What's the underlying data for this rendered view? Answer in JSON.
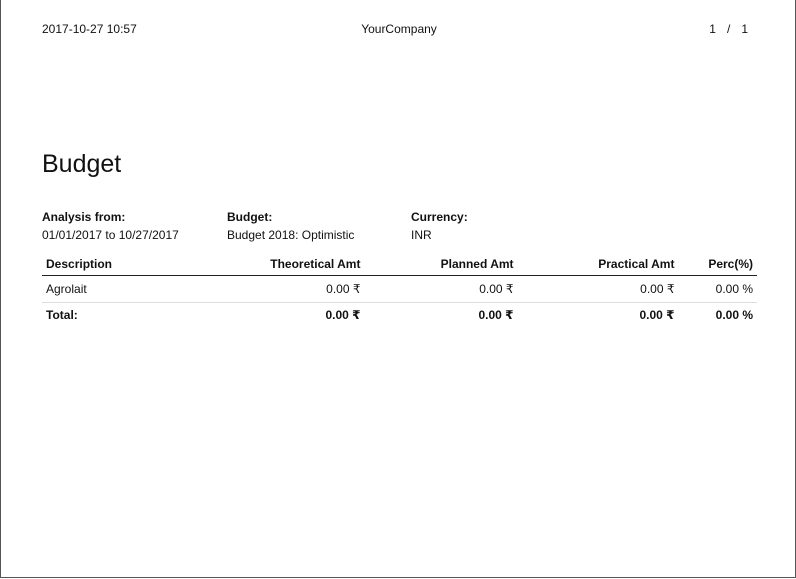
{
  "header": {
    "datetime": "2017-10-27 10:57",
    "company": "YourCompany",
    "page_current": "1",
    "page_separator": "/",
    "page_total": "1"
  },
  "title": "Budget",
  "info": {
    "analysis_label": "Analysis from:",
    "analysis_value": "01/01/2017 to 10/27/2017",
    "budget_label": "Budget:",
    "budget_value": "Budget 2018: Optimistic",
    "currency_label": "Currency:",
    "currency_value": "INR"
  },
  "table": {
    "columns": [
      "Description",
      "Theoretical Amt",
      "Planned Amt",
      "Practical Amt",
      "Perc(%)"
    ],
    "rows": [
      [
        "Agrolait",
        "0.00 ₹",
        "0.00 ₹",
        "0.00 ₹",
        "0.00 %"
      ]
    ],
    "total": [
      "Total:",
      "0.00 ₹",
      "0.00 ₹",
      "0.00 ₹",
      "0.00 %"
    ]
  }
}
